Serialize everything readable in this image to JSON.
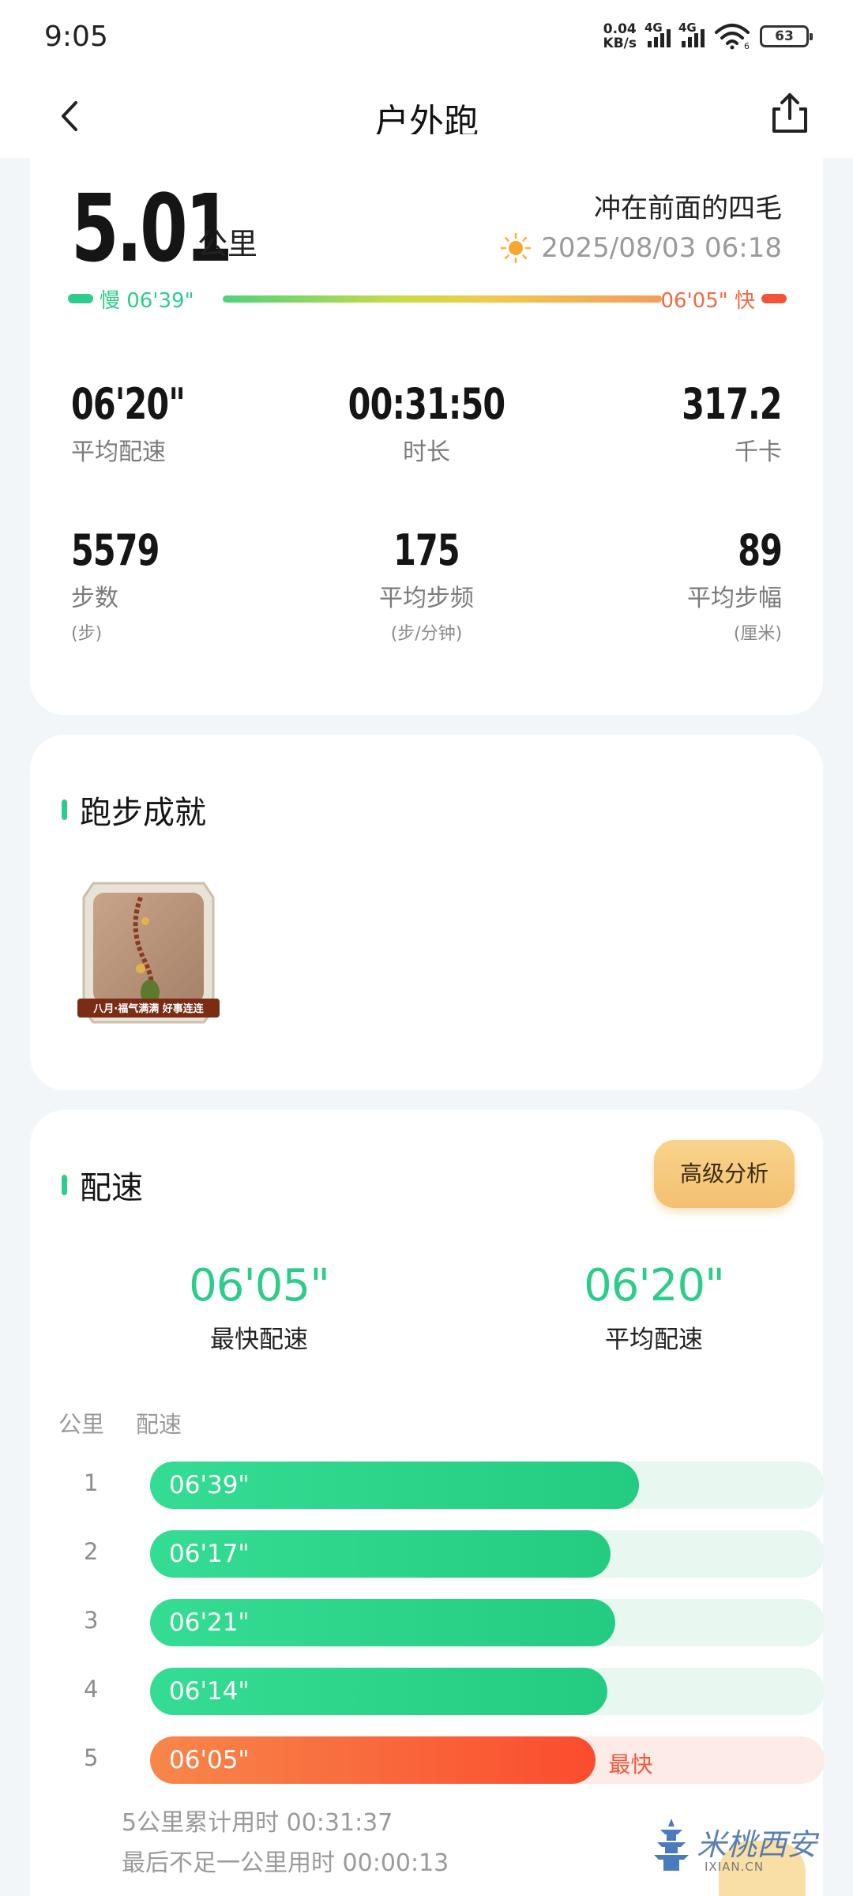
{
  "status_bar": {
    "time": "9:05",
    "net_speed_value": "0.04",
    "net_speed_unit": "KB/s",
    "sim1": "4G",
    "sim2": "4G",
    "wifi_badge": "6",
    "battery": "63"
  },
  "nav": {
    "title": "户外跑"
  },
  "summary": {
    "distance": "5.01",
    "distance_unit": "公里",
    "runner": "冲在前面的四毛",
    "date": "2025/08/03 06:18",
    "weather_icon": "sun-icon",
    "slow_label": "慢 06'39\"",
    "fast_label": "06'05\" 快",
    "stats": [
      {
        "value": "06'20\"",
        "label": "平均配速",
        "unit": ""
      },
      {
        "value": "00:31:50",
        "label": "时长",
        "unit": ""
      },
      {
        "value": "317.2",
        "label": "千卡",
        "unit": ""
      },
      {
        "value": "5579",
        "label": "步数",
        "unit": "(步)"
      },
      {
        "value": "175",
        "label": "平均步频",
        "unit": "(步/分钟)"
      },
      {
        "value": "89",
        "label": "平均步幅",
        "unit": "(厘米)"
      }
    ]
  },
  "achievements": {
    "title": "跑步成就",
    "medal_caption": "八月·福气满满 好事连连"
  },
  "pace": {
    "title": "配速",
    "advanced_button": "高级分析",
    "fastest_value": "06'05\"",
    "fastest_label": "最快配速",
    "average_value": "06'20\"",
    "average_label": "平均配速",
    "col_km": "公里",
    "col_pace": "配速",
    "splits": [
      {
        "km": "1",
        "pace": "06'39\"",
        "fill": 0.725
      },
      {
        "km": "2",
        "pace": "06'17\"",
        "fill": 0.683
      },
      {
        "km": "3",
        "pace": "06'21\"",
        "fill": 0.69
      },
      {
        "km": "4",
        "pace": "06'14\"",
        "fill": 0.678
      },
      {
        "km": "5",
        "pace": "06'05\"",
        "fill": 0.661,
        "tag": "最快"
      }
    ],
    "note1": "5公里累计用时 00:31:37",
    "note2": "最后不足一公里用时 00:00:13"
  },
  "watermark": {
    "text": "米桃西安",
    "url": "IXIAN.CN"
  },
  "colors": {
    "accent_green": "#2ecc8a",
    "accent_orange": "#f05a3a",
    "button_gold": "#f6c97c"
  }
}
